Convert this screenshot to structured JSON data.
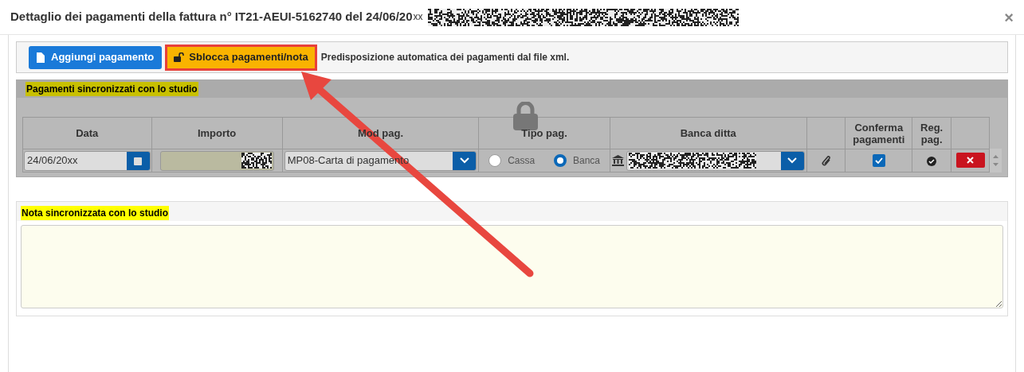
{
  "dialog": {
    "title": "Dettaglio dei pagamenti della fattura n° IT21-AEUI-5162740 del 24/06/20",
    "title_suffix": "xx",
    "close": "×"
  },
  "toolbar": {
    "buttons": [
      {
        "kind": "add",
        "label": "Aggiungi pagamento"
      },
      {
        "kind": "unlock",
        "label": "Sblocca pagamenti/nota",
        "highlighted": true
      }
    ],
    "info": "Predisposizione automatica dei pagamenti dal file xml."
  },
  "payments": {
    "title": "Pagamenti sincronizzati con lo studio",
    "locked": true,
    "columns": [
      "Data",
      "Importo",
      "Mod pag.",
      "Tipo pag.",
      "Banca ditta",
      "",
      "Conferma pagamenti",
      "Reg. pag.",
      ""
    ],
    "rows": [
      {
        "date": "24/06/20xx",
        "mode": "MP08-Carta di pagamento",
        "type_options": [
          {
            "label": "Cassa",
            "selected": false
          },
          {
            "label": "Banca",
            "selected": true
          }
        ],
        "confirmed": true,
        "registered": true
      }
    ]
  },
  "note": {
    "title": "Nota sincronizzata con lo studio"
  }
}
